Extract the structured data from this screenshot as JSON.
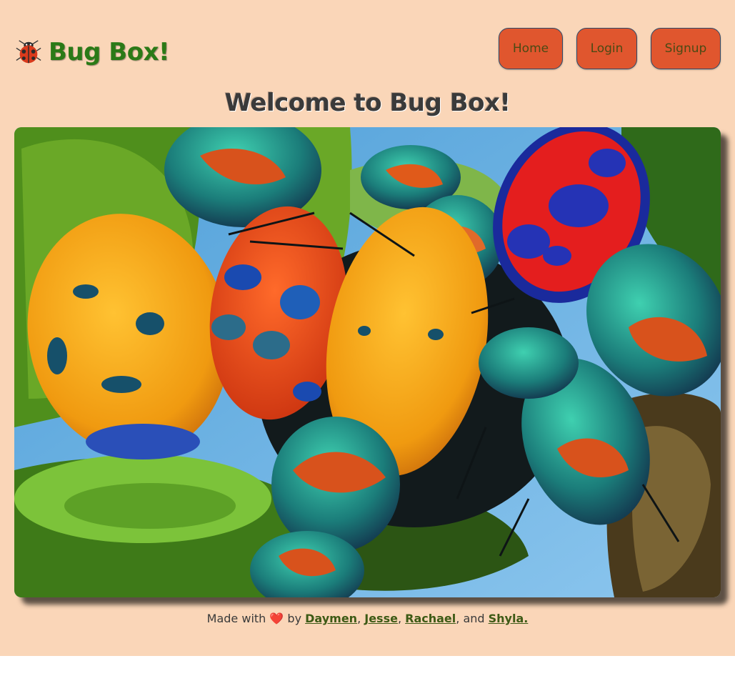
{
  "header": {
    "brand": "Bug Box!",
    "logo_icon": "ladybug-icon",
    "nav": [
      {
        "label": "Home"
      },
      {
        "label": "Login"
      },
      {
        "label": "Signup"
      }
    ]
  },
  "main": {
    "title": "Welcome to Bug Box!",
    "hero_image": "harlequin-bugs-photo"
  },
  "footer": {
    "made_with": "Made with",
    "heart_icon": "heart-icon",
    "by": "by",
    "authors": [
      "Daymen",
      "Jesse",
      "Rachael",
      "Shyla."
    ],
    "sep1": ",",
    "sep2": ",",
    "and": ", and"
  },
  "colors": {
    "background": "#fad6b8",
    "brand_green": "#2b7a17",
    "button": "#e0562e",
    "link": "#3d5a15"
  }
}
